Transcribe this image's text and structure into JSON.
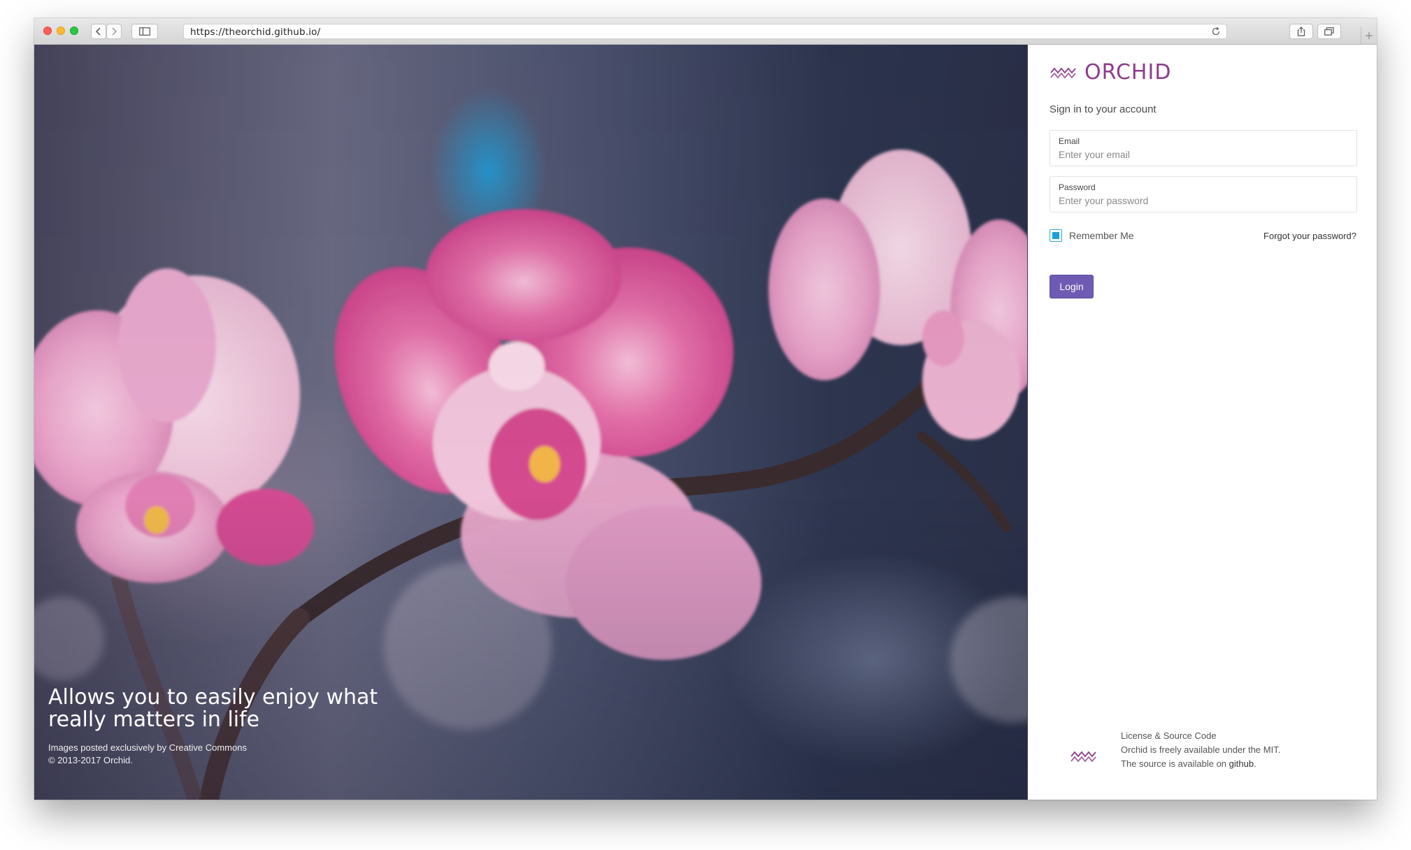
{
  "browser": {
    "url": "https://theorchid.github.io/"
  },
  "hero": {
    "title": "Allows you to easily enjoy what really matters in life",
    "credit": "Images posted exclusively by Creative Commons",
    "copyright": "© 2013-2017 Orchid."
  },
  "panel": {
    "brand_name": "ORCHID",
    "signin_title": "Sign in to your account",
    "email": {
      "label": "Email",
      "placeholder": "Enter your email",
      "value": ""
    },
    "password": {
      "label": "Password",
      "placeholder": "Enter your password",
      "value": ""
    },
    "remember_label": "Remember Me",
    "remember_checked": true,
    "forgot_label": "Forgot your password?",
    "login_label": "Login",
    "footer": {
      "line1": "License & Source Code",
      "line2": "Orchid is freely available under the MIT.",
      "line3_prefix": "The source is available on ",
      "line3_link": "github",
      "line3_suffix": "."
    }
  },
  "colors": {
    "brand": "#8d3b8c",
    "button": "#6f5bb3",
    "checkbox": "#1aa0d8"
  },
  "icons": [
    "back-arrow-icon",
    "forward-arrow-icon",
    "sidebar-icon",
    "reload-icon",
    "share-icon",
    "tabs-icon",
    "new-tab-icon",
    "orchid-logo-icon"
  ]
}
